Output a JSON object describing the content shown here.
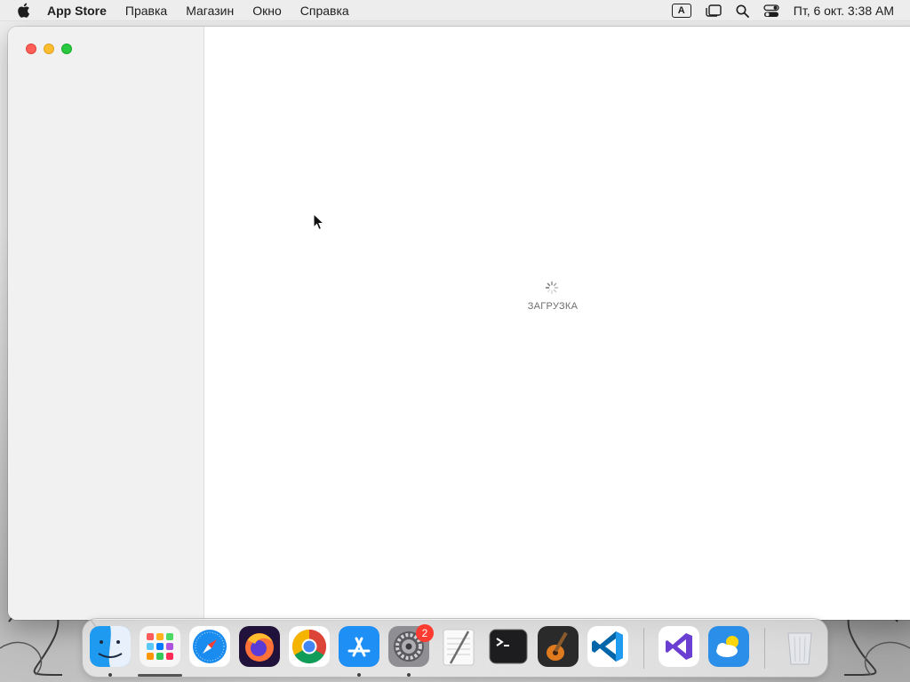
{
  "menubar": {
    "app_name": "App Store",
    "items": [
      "Правка",
      "Магазин",
      "Окно",
      "Справка"
    ],
    "input_source": "A",
    "clock": "Пт, 6 окт.  3:38 AM"
  },
  "window": {
    "loading_text": "ЗАГРУЗКА"
  },
  "dock": {
    "apps": [
      "finder",
      "launchpad",
      "safari",
      "firefox",
      "chrome",
      "app-store",
      "system-settings",
      "textedit",
      "terminal",
      "garageband",
      "vscode",
      "visual-studio",
      "weather",
      "trash"
    ],
    "system_settings_badge": "2"
  },
  "colors": {
    "close": "#fe5f57",
    "minimize": "#febc2e",
    "maximize": "#28c840",
    "badge": "#fe3b30"
  }
}
